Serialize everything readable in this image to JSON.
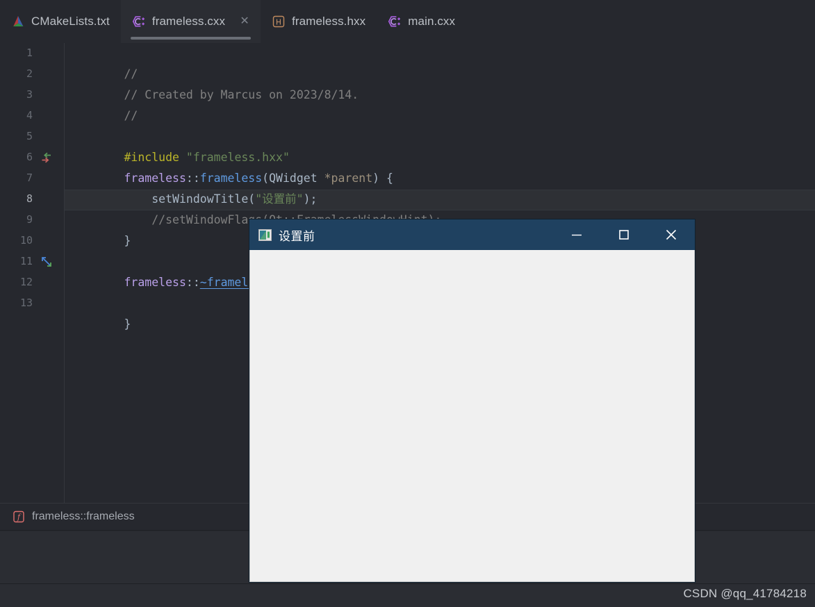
{
  "tabs": [
    {
      "label": "CMakeLists.txt",
      "icon": "cmake-icon",
      "active": false,
      "closable": false
    },
    {
      "label": "frameless.cxx",
      "icon": "cpp-source-icon",
      "active": true,
      "closable": true,
      "close_glyph": "✕"
    },
    {
      "label": "frameless.hxx",
      "icon": "cpp-header-icon",
      "active": false,
      "closable": false
    },
    {
      "label": "main.cxx",
      "icon": "cpp-source-icon",
      "active": false,
      "closable": false
    }
  ],
  "editor": {
    "current_line": 8,
    "line_numbers": [
      "1",
      "2",
      "3",
      "4",
      "5",
      "6",
      "7",
      "8",
      "9",
      "10",
      "11",
      "12",
      "13"
    ],
    "gutter_marks": [
      {
        "line": 6,
        "icon": "implementing-method-arrows-icon"
      },
      {
        "line": 11,
        "icon": "expand-diagonal-arrows-icon"
      }
    ],
    "lines": {
      "l1": "//",
      "l2": "// Created by Marcus on 2023/8/14.",
      "l3": "//",
      "l4": "",
      "l5_include_kw": "#include",
      "l5_string": "\"frameless.hxx\"",
      "l6_class": "frameless",
      "l6_scope": "::",
      "l6_fn": "frameless",
      "l6_open": "(",
      "l6_type": "QWidget",
      "l6_param": " *parent",
      "l6_tail": ") {",
      "l7": "    setWindowTitle(",
      "l7_str": "\"设置前\"",
      "l7_tail": ");",
      "l8": "    //setWindowFlags(Qt::FramelessWindowHint);",
      "l9": "}",
      "l10": "",
      "l11_class": "frameless",
      "l11_scope": "::",
      "l11_dtor": "~frameless",
      "l11_open": "(",
      "l12": "",
      "l13": "}"
    }
  },
  "breadcrumb": {
    "icon": "function-f-icon",
    "text": "frameless::frameless"
  },
  "qt_window": {
    "title": "设置前",
    "icon": "qt-window-icon",
    "minimize_glyph": "—",
    "maximize_glyph": "□",
    "close_glyph": "✕",
    "titlebar_color": "#1f4160",
    "body_color": "#f0f0f0"
  },
  "watermark": {
    "text": "CSDN @qq_41784218"
  }
}
